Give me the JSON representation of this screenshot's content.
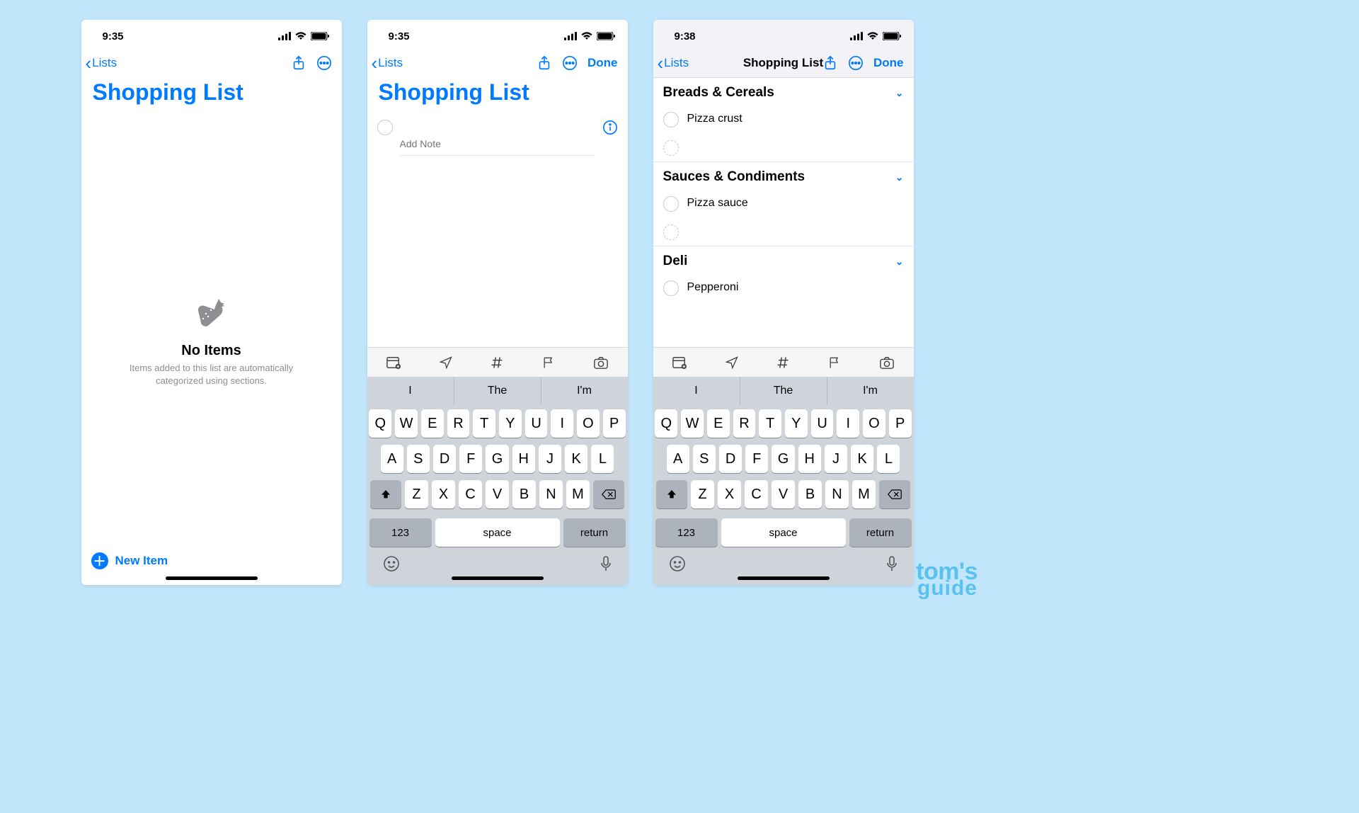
{
  "colors": {
    "accent": "#007aff"
  },
  "watermark": {
    "line1": "tom's",
    "line2": "guide"
  },
  "status": {
    "time1": "9:35",
    "time2": "9:35",
    "time3": "9:38"
  },
  "nav": {
    "back_label": "Lists",
    "done_label": "Done",
    "title_small": "Shopping List"
  },
  "title": "Shopping List",
  "empty": {
    "heading": "No Items",
    "sub": "Items added to this list are automatically categorized using sections."
  },
  "new_item_label": "New Item",
  "new_reminder": {
    "title_placeholder": "",
    "note_placeholder": "Add Note"
  },
  "sections": [
    {
      "name": "Breads & Cereals",
      "items": [
        "Pizza crust"
      ]
    },
    {
      "name": "Sauces & Condiments",
      "items": [
        "Pizza sauce"
      ]
    },
    {
      "name": "Deli",
      "items": [
        "Pepperoni"
      ]
    }
  ],
  "keyboard": {
    "suggestions": [
      "I",
      "The",
      "I'm"
    ],
    "row1": [
      "Q",
      "W",
      "E",
      "R",
      "T",
      "Y",
      "U",
      "I",
      "O",
      "P"
    ],
    "row2": [
      "A",
      "S",
      "D",
      "F",
      "G",
      "H",
      "J",
      "K",
      "L"
    ],
    "row3": [
      "Z",
      "X",
      "C",
      "V",
      "B",
      "N",
      "M"
    ],
    "numkey": "123",
    "space": "space",
    "return": "return"
  }
}
